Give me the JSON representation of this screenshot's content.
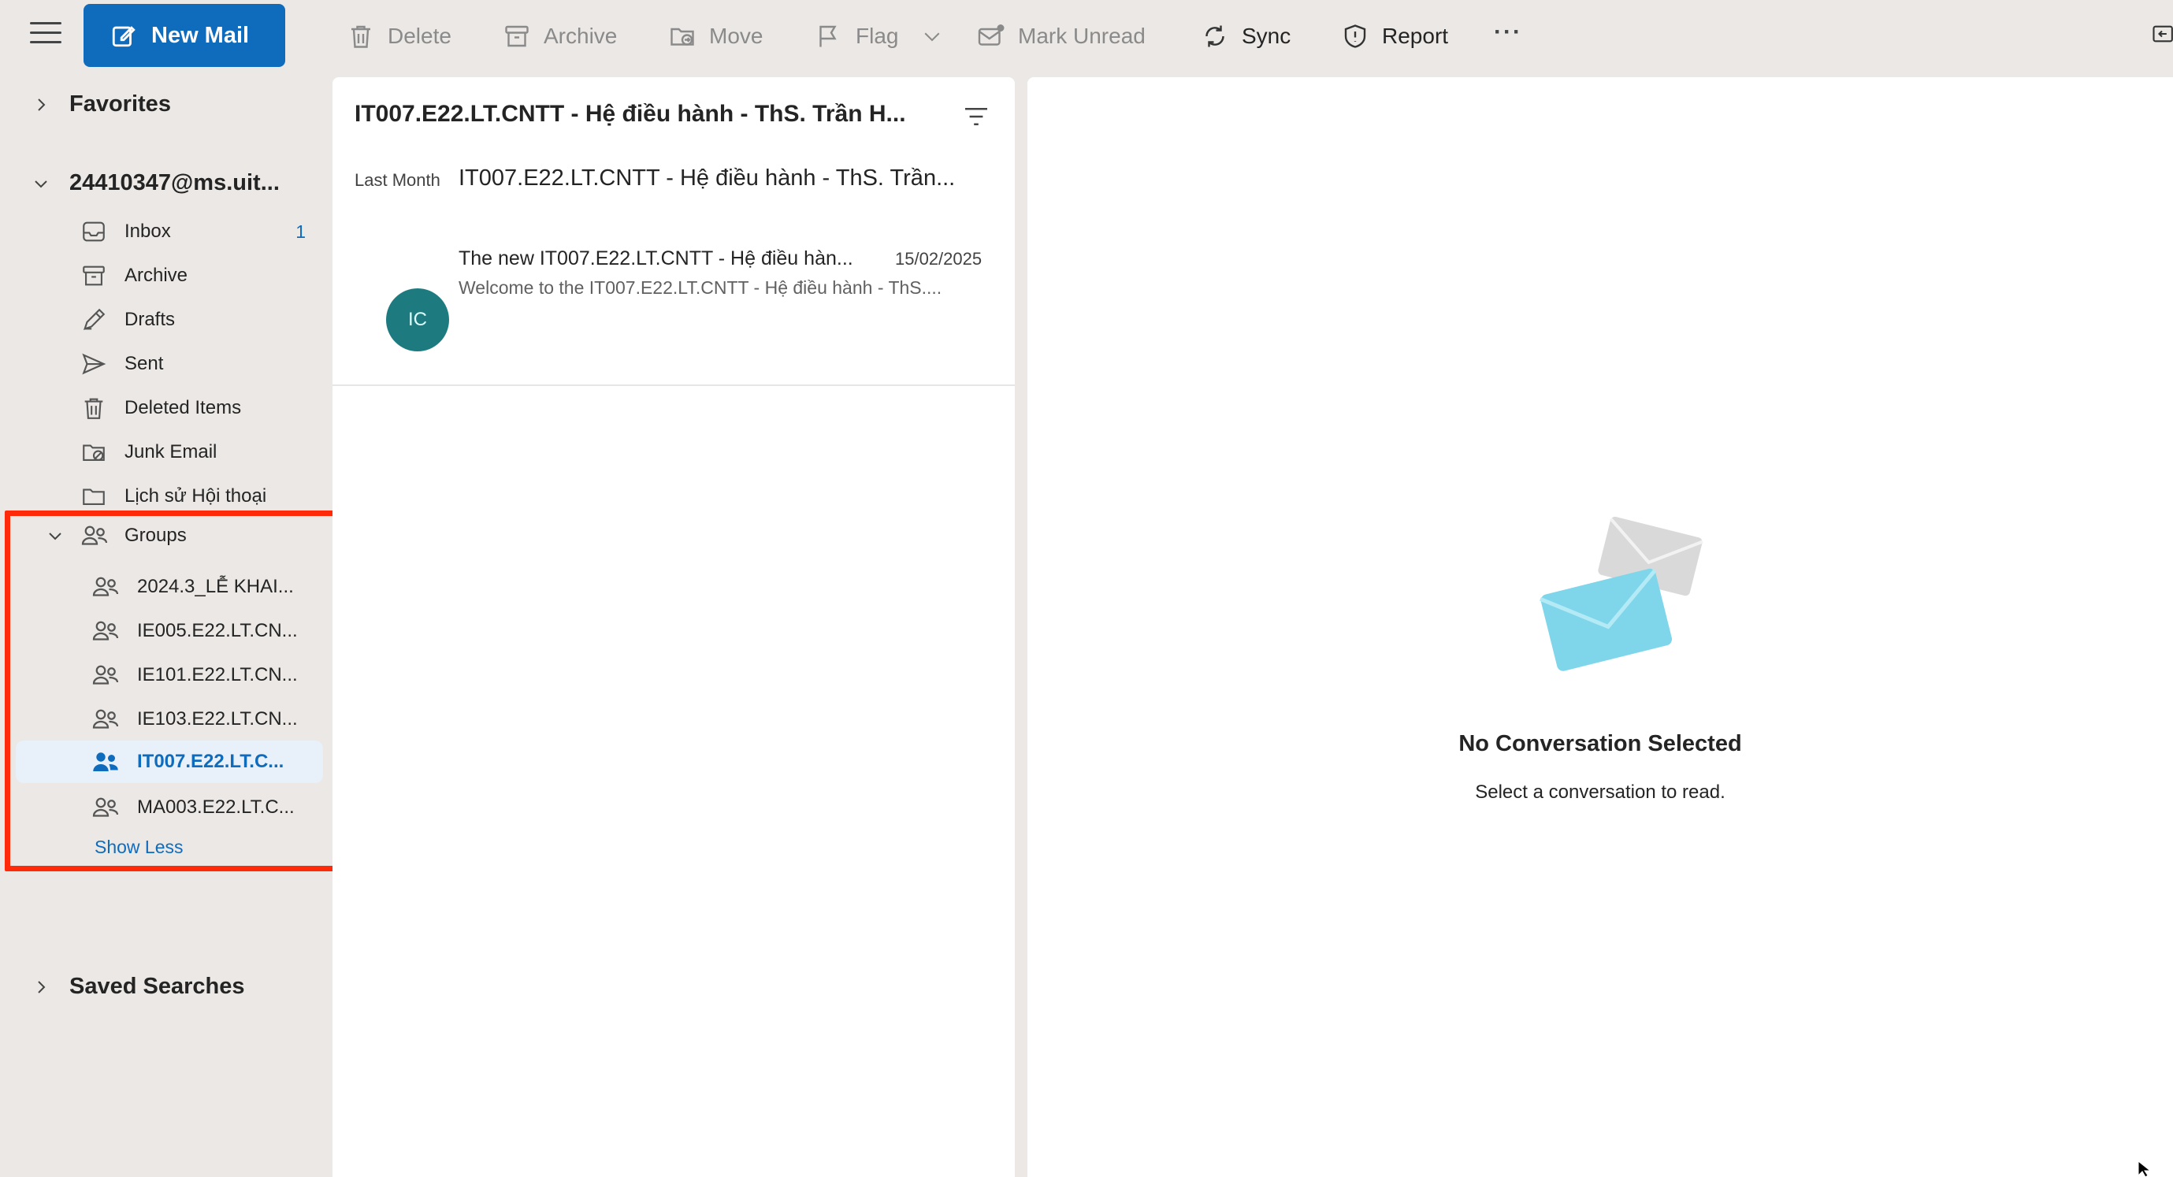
{
  "toolbar": {
    "new_mail": "New Mail",
    "delete": "Delete",
    "archive": "Archive",
    "move": "Move",
    "flag": "Flag",
    "mark_unread": "Mark Unread",
    "sync": "Sync",
    "report": "Report",
    "more": "···"
  },
  "sidebar": {
    "favorites": "Favorites",
    "account": "24410347@ms.uit...",
    "folders": [
      {
        "label": "Inbox",
        "count": "1",
        "icon": "inbox-icon"
      },
      {
        "label": "Archive",
        "icon": "archive-icon"
      },
      {
        "label": "Drafts",
        "icon": "drafts-icon"
      },
      {
        "label": "Sent",
        "icon": "sent-icon"
      },
      {
        "label": "Deleted Items",
        "icon": "trash-icon"
      },
      {
        "label": "Junk Email",
        "icon": "junk-icon"
      },
      {
        "label": "Lịch sử Hội thoại",
        "icon": "folder-icon"
      }
    ],
    "groups_label": "Groups",
    "groups": [
      {
        "label": "2024.3_LỄ KHAI..."
      },
      {
        "label": "IE005.E22.LT.CN..."
      },
      {
        "label": "IE101.E22.LT.CN..."
      },
      {
        "label": "IE103.E22.LT.CN..."
      },
      {
        "label": "IT007.E22.LT.C...",
        "selected": true
      },
      {
        "label": "MA003.E22.LT.C..."
      }
    ],
    "show_less": "Show Less",
    "saved_searches": "Saved Searches"
  },
  "message_list": {
    "title": "IT007.E22.LT.CNTT - Hệ điều hành - ThS. Trần H...",
    "group_header": "Last Month",
    "messages": [
      {
        "avatar_initials": "IC",
        "sender": "IT007.E22.LT.CNTT - Hệ điều hành - ThS. Trần...",
        "subject": "The new IT007.E22.LT.CNTT - Hệ điều hàn...",
        "date": "15/02/2025",
        "preview": "Welcome to the IT007.E22.LT.CNTT - Hệ điều hành - ThS...."
      }
    ]
  },
  "reading_pane": {
    "empty_title": "No Conversation Selected",
    "empty_subtitle": "Select a conversation to read."
  },
  "colors": {
    "accent": "#0f6cbd",
    "avatar": "#1d7b80",
    "highlight": "#ff2a0a",
    "sidebar_bg": "#ebe8e5"
  }
}
